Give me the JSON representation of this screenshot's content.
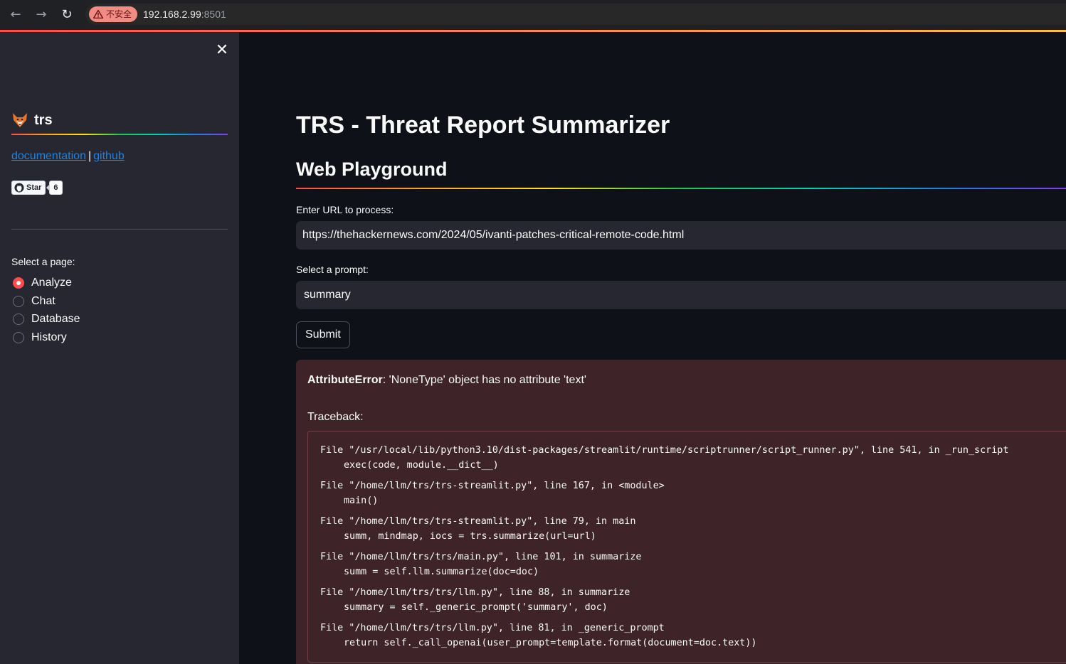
{
  "browser": {
    "security_chip": "不安全",
    "url_host": "192.168.2.99",
    "url_port": ":8501",
    "back_icon": "arrow-left-icon",
    "forward_icon": "arrow-right-icon",
    "reload_icon": "reload-icon"
  },
  "sidebar": {
    "close_icon": "close-icon",
    "brand_name": "trs",
    "links": {
      "documentation": "documentation",
      "separator": "|",
      "github": "github"
    },
    "github_badge": {
      "label": "Star",
      "count": "6"
    },
    "page_select_label": "Select a page:",
    "pages": [
      {
        "label": "Analyze",
        "selected": true
      },
      {
        "label": "Chat",
        "selected": false
      },
      {
        "label": "Database",
        "selected": false
      },
      {
        "label": "History",
        "selected": false
      }
    ]
  },
  "main": {
    "title": "TRS - Threat Report Summarizer",
    "subtitle": "Web Playground",
    "url_label": "Enter URL to process:",
    "url_value": "https://thehackernews.com/2024/05/ivanti-patches-critical-remote-code.html",
    "prompt_label": "Select a prompt:",
    "prompt_value": "summary",
    "submit_label": "Submit",
    "error": {
      "type": "AttributeError",
      "message": ": 'NoneType' object has no attribute 'text'",
      "traceback_label": "Traceback:",
      "frames": [
        {
          "file_line": "File \"/usr/local/lib/python3.10/dist-packages/streamlit/runtime/scriptrunner/script_runner.py\", line 541, in _run_script",
          "code": "exec(code, module.__dict__)"
        },
        {
          "file_line": "File \"/home/llm/trs/trs-streamlit.py\", line 167, in <module>",
          "code": "main()"
        },
        {
          "file_line": "File \"/home/llm/trs/trs-streamlit.py\", line 79, in main",
          "code": "summ, mindmap, iocs = trs.summarize(url=url)"
        },
        {
          "file_line": "File \"/home/llm/trs/trs/main.py\", line 101, in summarize",
          "code": "summ = self.llm.summarize(doc=doc)"
        },
        {
          "file_line": "File \"/home/llm/trs/trs/llm.py\", line 88, in summarize",
          "code": "summary = self._generic_prompt('summary', doc)"
        },
        {
          "file_line": "File \"/home/llm/trs/trs/llm.py\", line 81, in _generic_prompt",
          "code": "return self._call_openai(user_prompt=template.format(document=doc.text))"
        }
      ]
    }
  },
  "colors": {
    "accent": "#ff4b4b",
    "link": "#1c83e1",
    "sidebar_bg": "#262730",
    "main_bg": "#0e1117",
    "error_bg": "#3e2428"
  }
}
